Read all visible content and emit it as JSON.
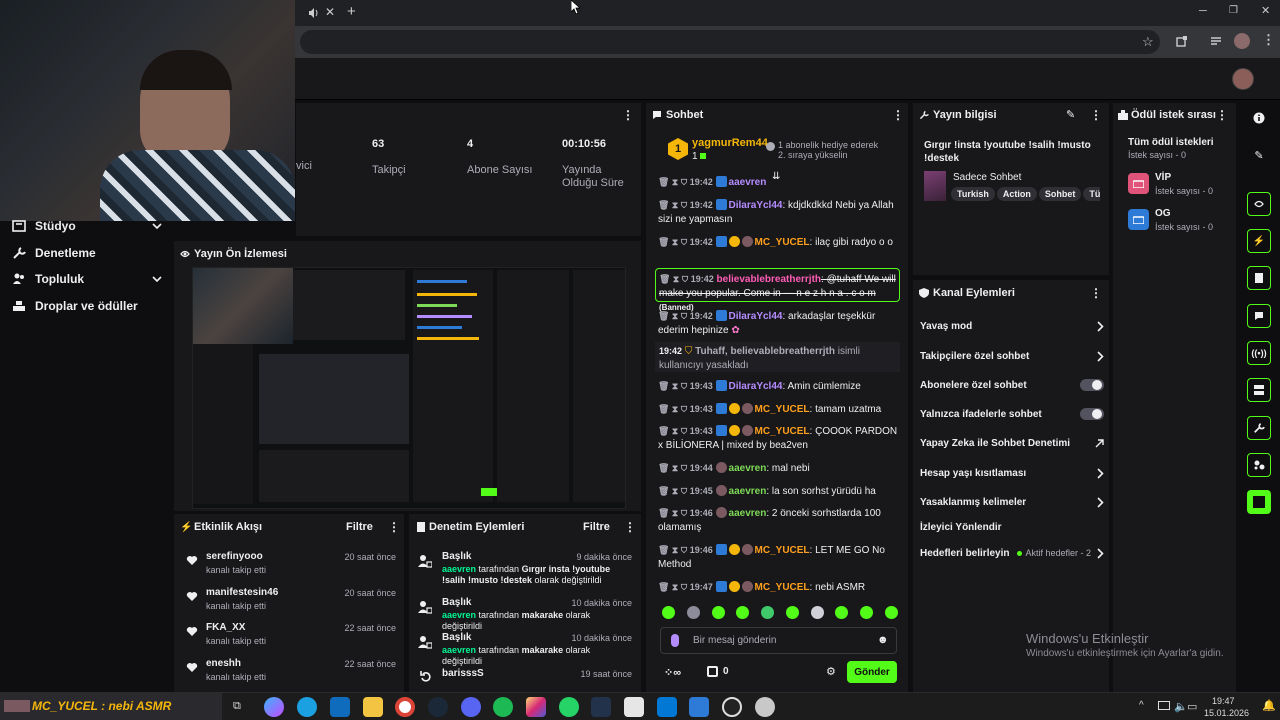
{
  "browser": {
    "tab_audio_icon": "speaker-icon"
  },
  "nav": {
    "items": [
      {
        "label": "Stüdyo",
        "icon": "studio-icon",
        "chevron": true
      },
      {
        "label": "Denetleme",
        "icon": "wrench-icon",
        "chevron": false
      },
      {
        "label": "Topluluk",
        "icon": "community-icon",
        "chevron": true
      },
      {
        "label": "Droplar ve ödüller",
        "icon": "drops-icon",
        "chevron": false
      }
    ]
  },
  "stats": {
    "partial_label": "vici",
    "items": [
      {
        "value": "63",
        "label": "Takipçi"
      },
      {
        "value": "4",
        "label": "Abone Sayısı"
      },
      {
        "value": "00:10:56",
        "label": "Yayında Olduğu Süre"
      }
    ]
  },
  "preview": {
    "title": "Yayın Ön İzlemesi"
  },
  "activity": {
    "title": "Etkinlik Akışı",
    "filter": "Filtre",
    "items": [
      {
        "name": "serefinyooo",
        "sub": "kanalı takip etti",
        "time": "20 saat önce"
      },
      {
        "name": "manifestesin46",
        "sub": "kanalı takip etti",
        "time": "20 saat önce"
      },
      {
        "name": "FKA_XX",
        "sub": "kanalı takip etti",
        "time": "22 saat önce"
      },
      {
        "name": "eneshh",
        "sub": "kanalı takip etti",
        "time": "22 saat önce"
      }
    ]
  },
  "moderation": {
    "title": "Denetim Eylemleri",
    "filter": "Filtre",
    "items": [
      {
        "title": "Başlık",
        "time": "9 dakika önce",
        "user": "aaevren",
        "mid": " tarafından ",
        "value": "Gırgır insta !youtube !salih !musto !destek",
        "end": " olarak değiştirildi"
      },
      {
        "title": "Başlık",
        "time": "10 dakika önce",
        "user": "aaevren",
        "mid": " tarafından ",
        "value": "makarake",
        "end": " olarak değiştirildi"
      },
      {
        "title": "Başlık",
        "time": "10 dakika önce",
        "user": "aaevren",
        "mid": " tarafından ",
        "value": "makarake",
        "end": " olarak değiştirildi"
      },
      {
        "title": "barisssS",
        "time": "19 saat önce"
      }
    ]
  },
  "chat": {
    "title": "Sohbet",
    "gift": {
      "user": "yagmurRem44",
      "count": "1",
      "text": "1 abonelik hediye ederek 2. sıraya yükselin"
    },
    "messages": [
      {
        "time": "19:42",
        "user": "aaevren",
        "text": ""
      },
      {
        "time": "19:42",
        "user": "DilaraYcl44",
        "text": ": kdjdkdkkd Nebi ya Allah sizi ne yapmasın"
      },
      {
        "time": "19:42",
        "user": "MC_YUCEL",
        "text": ": ilaç gibi radyo o o"
      },
      {
        "time": "19:42",
        "user": "believablebreatherrjth",
        "text": ": @tuhaff We will make you popular. Come in — n e z h n a . c o m",
        "banned": "(Banned)"
      },
      {
        "time": "19:42",
        "user": "DilaraYcl44",
        "text": ": arkadaşlar teşekkür ederim hepinize"
      },
      {
        "time": "19:42",
        "user": "Tuhaff, believablebreatherrjth",
        "text": " isimli kullanıcıyı yasakladı"
      },
      {
        "time": "19:43",
        "user": "DilaraYcl44",
        "text": ": Amin cümlemize"
      },
      {
        "time": "19:43",
        "user": "MC_YUCEL",
        "text": ": tamam uzatma"
      },
      {
        "time": "19:43",
        "user": "MC_YUCEL",
        "text": ": ÇOOOK PARDON x BİLİONERA | mixed by bea2ven"
      },
      {
        "time": "19:44",
        "user": "aaevren",
        "text": ": mal nebi"
      },
      {
        "time": "19:45",
        "user": "aaevren",
        "text": ": la son sorhst yürüdü ha"
      },
      {
        "time": "19:46",
        "user": "aaevren",
        "text": ": 2 önceki sorhstlarda 100 olamamış"
      },
      {
        "time": "19:46",
        "user": "MC_YUCEL",
        "text": ": LET ME GO No Method"
      },
      {
        "time": "19:47",
        "user": "MC_YUCEL",
        "text": ": nebi ASMR"
      }
    ],
    "input_placeholder": "Bir mesaj gönderin",
    "points": "0",
    "send": "Gönder"
  },
  "stream_info": {
    "title": "Yayın bilgisi",
    "stream_title": "Gırgır !insta !youtube !salih !musto !destek",
    "category": "Sadece Sohbet",
    "tags": [
      "Turkish",
      "Action",
      "Sohbet",
      "Tür"
    ]
  },
  "channel_actions": {
    "title": "Kanal Eylemleri",
    "items": [
      {
        "label": "Yavaş mod",
        "type": "chevron"
      },
      {
        "label": "Takipçilere özel sohbet",
        "type": "chevron"
      },
      {
        "label": "Abonelere özel sohbet",
        "type": "toggle"
      },
      {
        "label": "Yalnızca ifadelerle sohbet",
        "type": "toggle"
      },
      {
        "label": "Yapay Zeka ile Sohbet Denetimi",
        "type": "external"
      },
      {
        "label": "Hesap yaşı kısıtlaması",
        "type": "chevron"
      },
      {
        "label": "Yasaklanmış kelimeler",
        "type": "chevron"
      },
      {
        "label": "İzleyici Yönlendir",
        "type": "none"
      },
      {
        "label": "Hedefleri belirleyin",
        "type": "goals",
        "extra": "Aktif hedefler - 2"
      }
    ]
  },
  "rewards": {
    "title": "Ödül istek sırası",
    "all_label": "Tüm ödül istekleri",
    "all_count": "İstek sayısı - 0",
    "items": [
      {
        "name": "VİP",
        "count": "İstek sayısı - 0",
        "color": "#e0547a"
      },
      {
        "name": "OG",
        "count": "İstek sayısı - 0",
        "color": "#2d7bd6"
      }
    ]
  },
  "watermark": {
    "line1": "Windows'u Etkinleştir",
    "line2": "Windows'u etkinleştirmek için Ayarlar'a gidin."
  },
  "taskbar": {
    "preview_text": "MC_YUCEL : nebi ASMR",
    "time": "19:47",
    "date": "15.01.2026"
  },
  "colors": {
    "accent": "#53fc18",
    "bg": "#0e0e10",
    "panel": "#18181b"
  }
}
